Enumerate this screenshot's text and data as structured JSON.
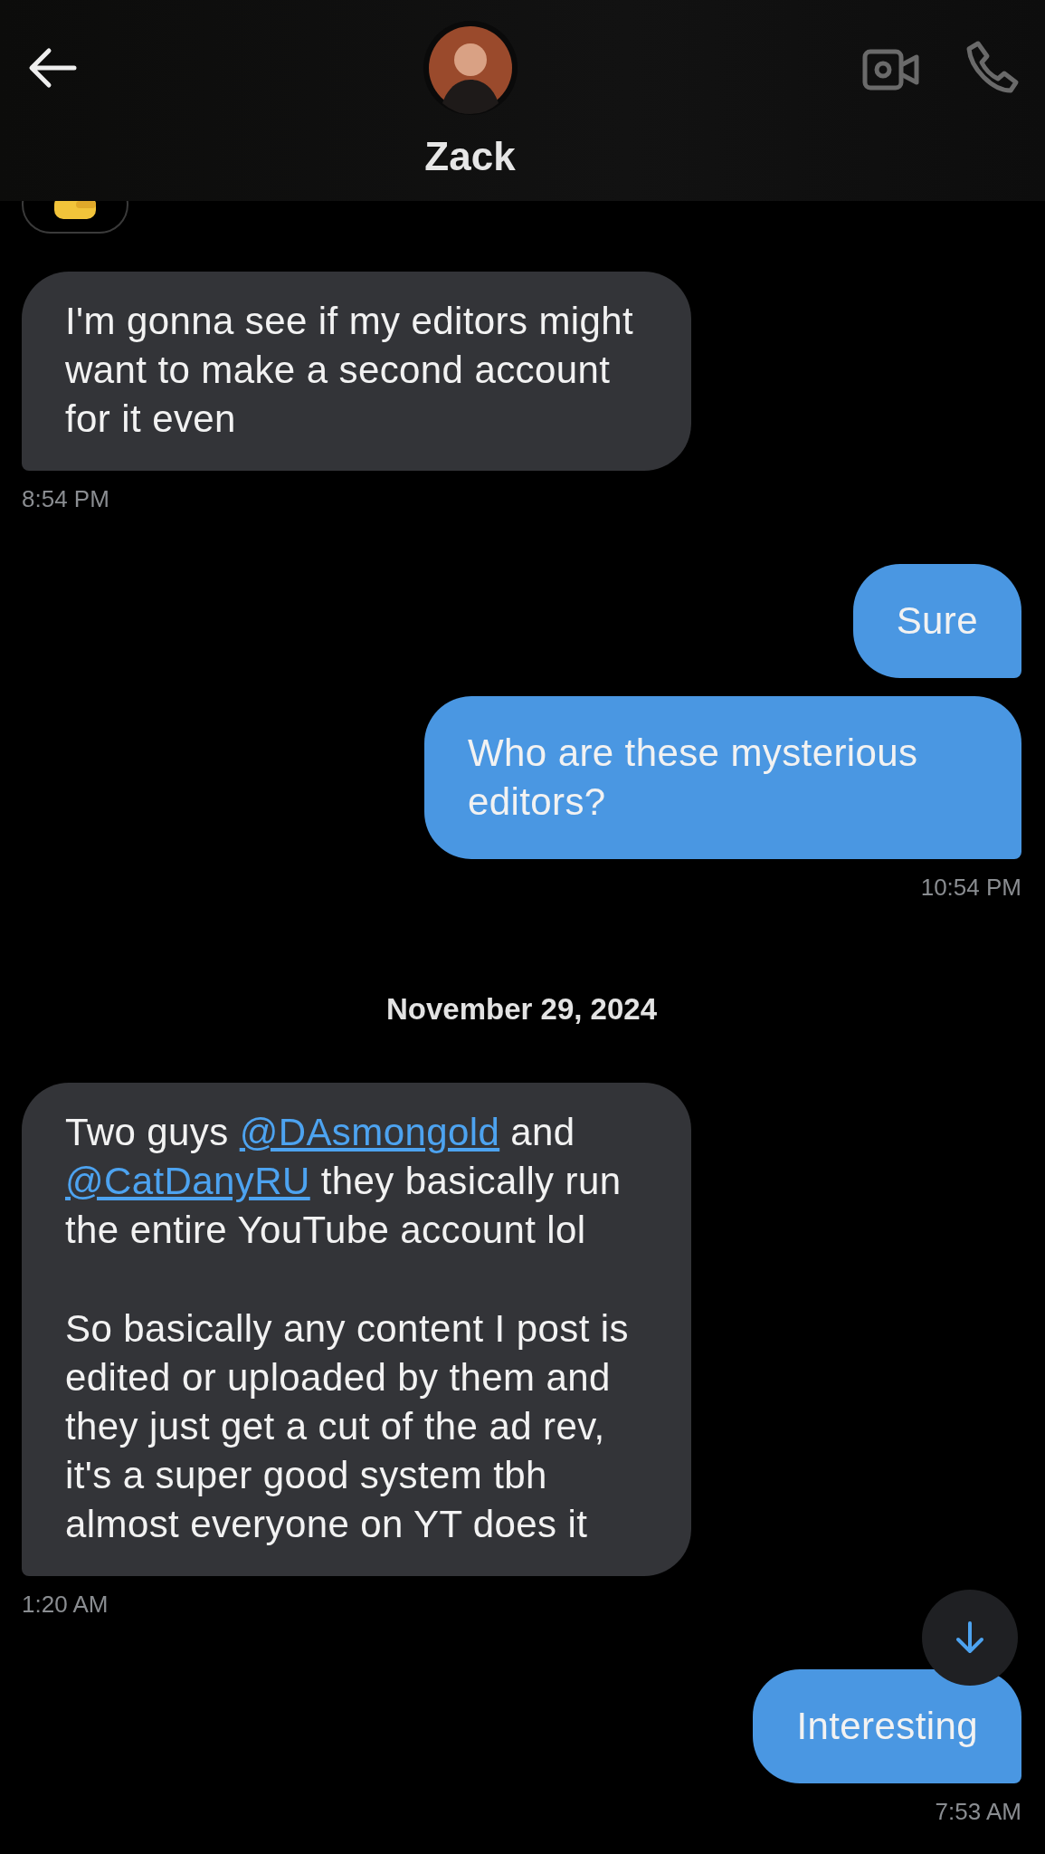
{
  "header": {
    "name": "Zack"
  },
  "items": [
    {
      "kind": "received",
      "paragraphs": [
        [
          {
            "text": "I'm gonna see if my editors might want to make a second account for it even"
          }
        ]
      ],
      "time": "8:54 PM"
    },
    {
      "kind": "sent",
      "paragraphs": [
        [
          {
            "text": "Sure"
          }
        ]
      ]
    },
    {
      "kind": "sent",
      "paragraphs": [
        [
          {
            "text": "Who are these mysterious editors?"
          }
        ]
      ],
      "time": "10:54 PM"
    },
    {
      "kind": "date",
      "text": "November 29, 2024"
    },
    {
      "kind": "received",
      "paragraphs": [
        [
          {
            "text": "Two guys "
          },
          {
            "text": "@DAsmongold",
            "link": true
          },
          {
            "text": " and "
          },
          {
            "text": "@CatDanyRU",
            "link": true
          },
          {
            "text": " they basically run the entire YouTube account lol"
          }
        ],
        [
          {
            "text": "So basically any content I post is edited or uploaded by them and they just get a cut of the ad rev, it's a super good system tbh almost everyone on YT does it"
          }
        ]
      ],
      "time": "1:20 AM"
    },
    {
      "kind": "sent",
      "paragraphs": [
        [
          {
            "text": "Interesting"
          }
        ]
      ],
      "time": "7:53 AM"
    }
  ]
}
